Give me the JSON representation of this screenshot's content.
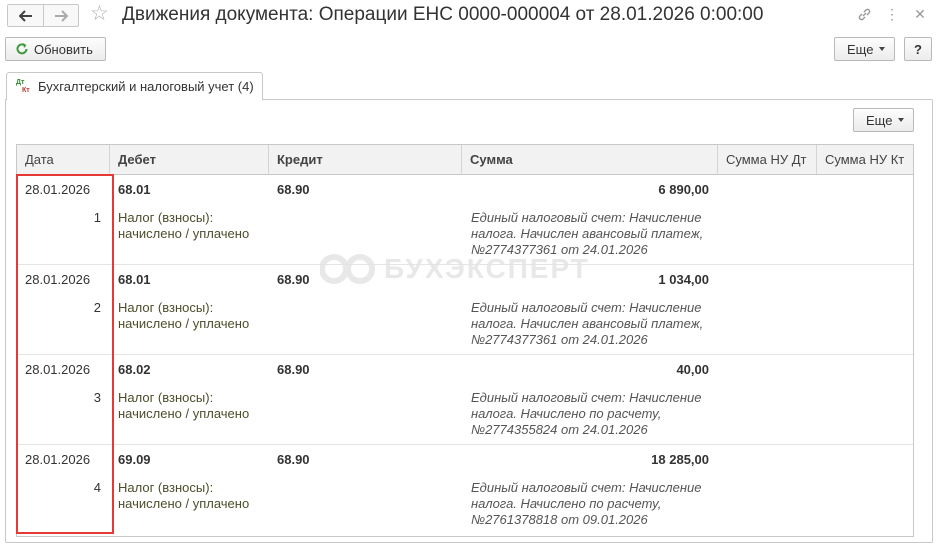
{
  "window": {
    "title": "Движения документа: Операции ЕНС 0000-000004 от 28.01.2026 0:00:00",
    "icons": [
      "back-arrow-icon",
      "forward-arrow-icon",
      "star-icon",
      "link-icon",
      "kebab-menu-icon",
      "close-icon"
    ]
  },
  "toolbar": {
    "refresh_label": "Обновить",
    "more_label": "Еще",
    "help_label": "?"
  },
  "tab": {
    "label": "Бухгалтерский и налоговый учет (4)",
    "icon_top": "Дт",
    "icon_bottom": "Кт"
  },
  "panel": {
    "more_label": "Еще"
  },
  "table": {
    "columns": [
      "Дата",
      "Дебет",
      "Кредит",
      "Сумма",
      "Сумма НУ Дт",
      "Сумма НУ Кт"
    ],
    "rows": [
      {
        "date": "28.01.2026",
        "number": "1",
        "debit": "68.01",
        "debit_sub1": "Налог (взносы):",
        "debit_sub2": "начислено / уплачено",
        "credit": "68.90",
        "amount": "6 890,00",
        "content1": "Единый налоговый счет: Начисление",
        "content2": "налога. Начислен авансовый платеж,",
        "content3": "№2774377361 от 24.01.2026"
      },
      {
        "date": "28.01.2026",
        "number": "2",
        "debit": "68.01",
        "debit_sub1": "Налог (взносы):",
        "debit_sub2": "начислено / уплачено",
        "credit": "68.90",
        "amount": "1 034,00",
        "content1": "Единый налоговый счет: Начисление",
        "content2": "налога. Начислен авансовый платеж,",
        "content3": "№2774377361 от 24.01.2026"
      },
      {
        "date": "28.01.2026",
        "number": "3",
        "debit": "68.02",
        "debit_sub1": "Налог (взносы):",
        "debit_sub2": "начислено / уплачено",
        "credit": "68.90",
        "amount": "40,00",
        "content1": "Единый налоговый счет: Начисление",
        "content2": "налога. Начислено по расчету,",
        "content3": "№2774355824 от 24.01.2026"
      },
      {
        "date": "28.01.2026",
        "number": "4",
        "debit": "69.09",
        "debit_sub1": "Налог (взносы):",
        "debit_sub2": "начислено / уплачено",
        "credit": "68.90",
        "amount": "18 285,00",
        "content1": "Единый налоговый счет: Начисление",
        "content2": "налога. Начислено по расчету,",
        "content3": "№2761378818 от 09.01.2026"
      }
    ]
  },
  "watermark": "БУХЭКСПЕРТ",
  "colors": {
    "highlight": "#e53935",
    "accent_green": "#2a8a2a",
    "header_bg": "#f2f2f2",
    "border": "#c8c8c8"
  }
}
